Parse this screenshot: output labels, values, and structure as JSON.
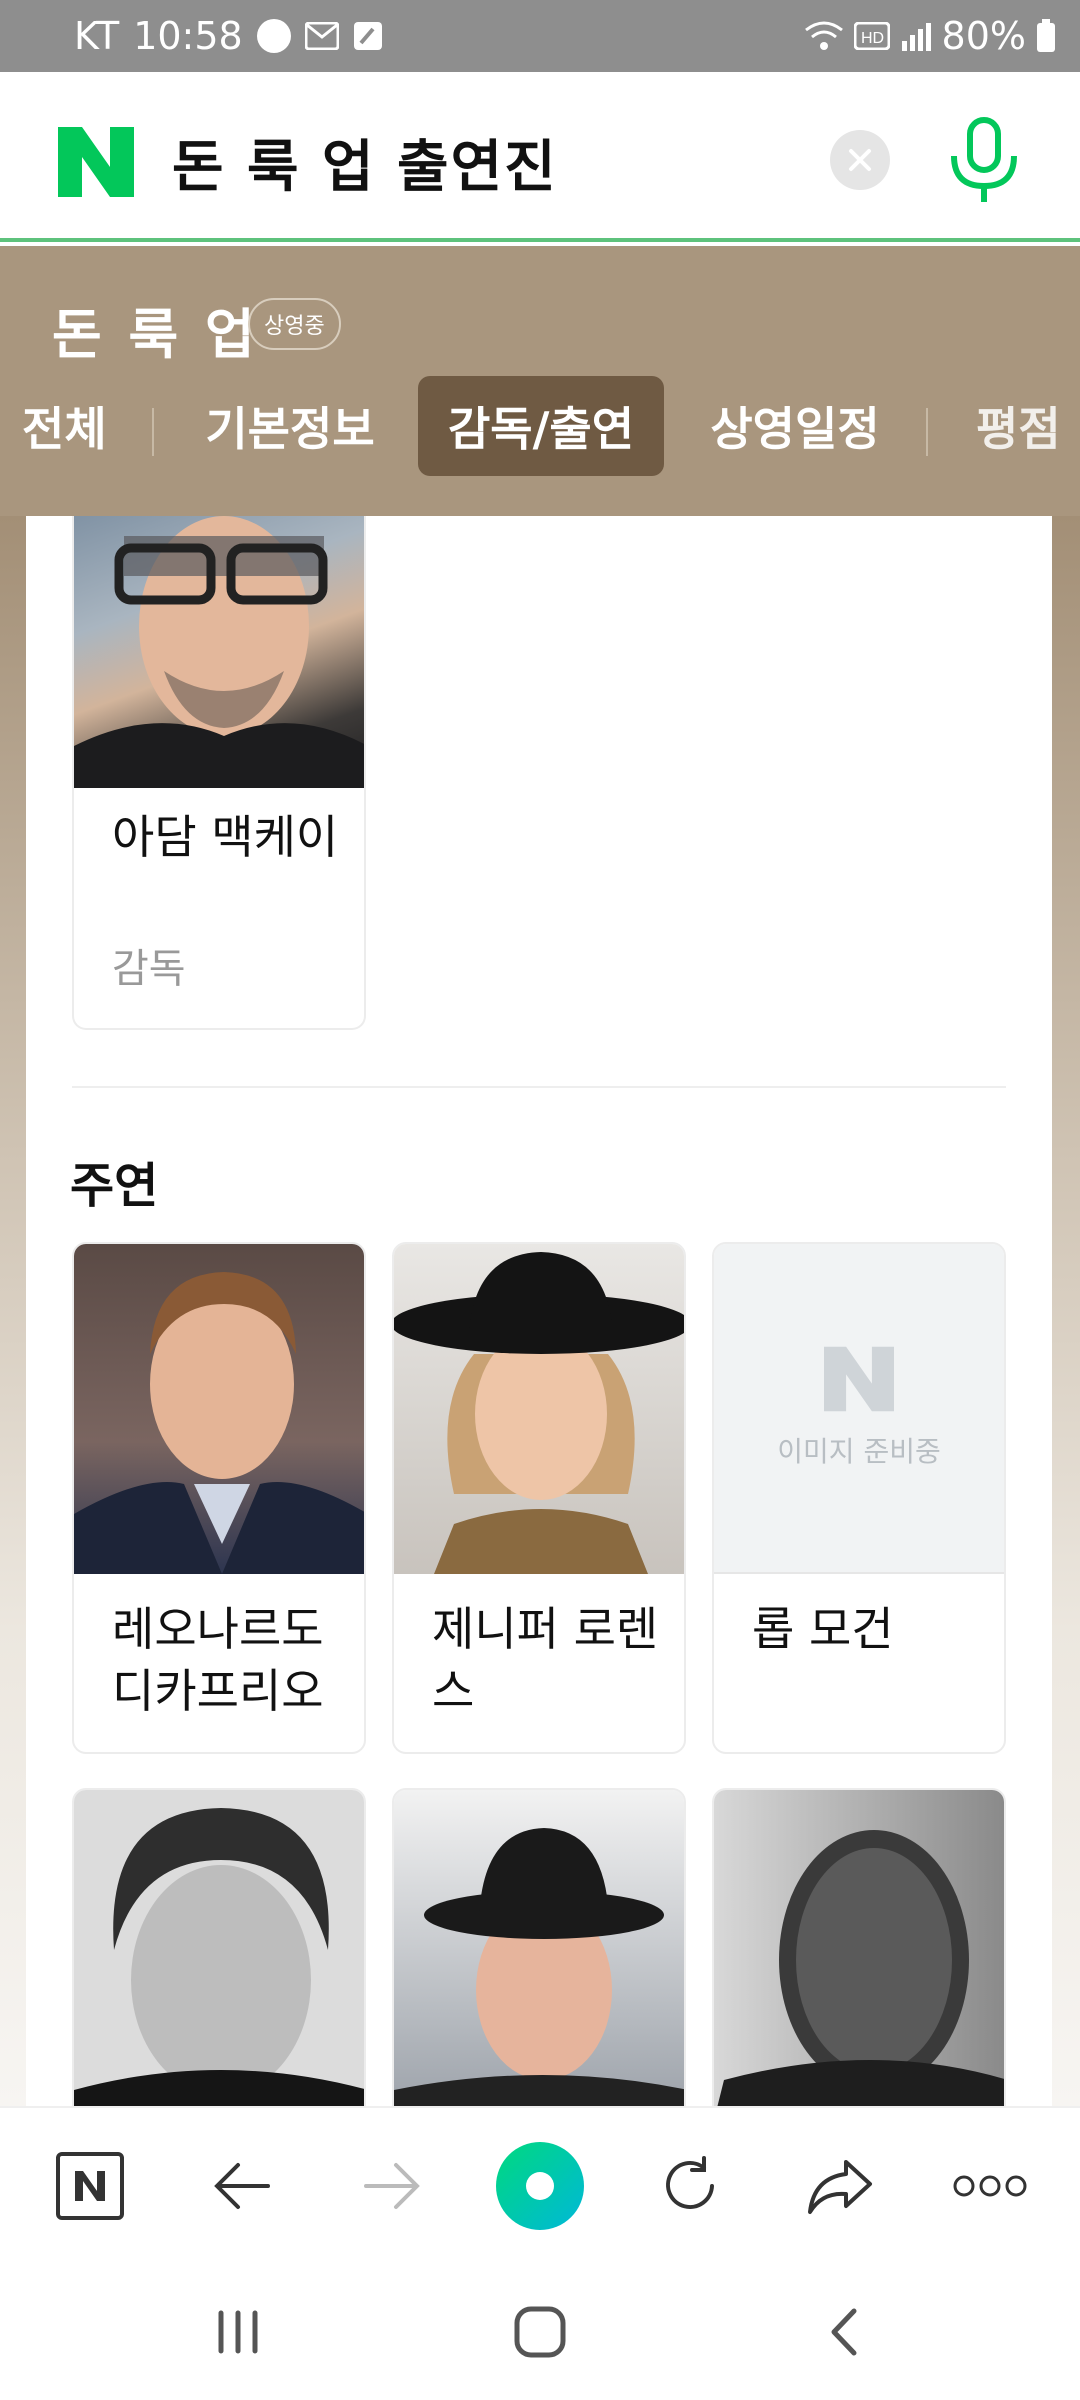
{
  "status_bar": {
    "carrier": "KT",
    "time": "10:58",
    "battery": "80%",
    "icons": [
      "x-app-icon",
      "mail-icon",
      "edit-icon",
      "wifi-icon",
      "hd-voice-icon",
      "signal-icon",
      "battery-icon"
    ]
  },
  "search": {
    "query": "돈 룩 업 출연진",
    "icons": [
      "naver-logo-icon",
      "clear-icon",
      "mic-icon"
    ],
    "accent_color": "#03c75a"
  },
  "movie": {
    "title": "돈 룩 업",
    "status": "상영중",
    "tabs": [
      "전체",
      "기본정보",
      "감독/출연",
      "상영일정",
      "평점"
    ],
    "active_tab": "감독/출연",
    "header_color": "#a9967e"
  },
  "director": {
    "name": "아담 맥케이",
    "role": "감독"
  },
  "cast_section": {
    "title": "주연",
    "people": [
      {
        "name": "레오나르도 디카프리오"
      },
      {
        "name": "제니퍼 로렌스"
      },
      {
        "name": "롭 모건",
        "placeholder": "이미지 준비중"
      }
    ]
  },
  "toolbar": {
    "icons": [
      "naver-home-icon",
      "back-arrow-icon",
      "forward-arrow-icon",
      "green-dot-icon",
      "refresh-icon",
      "share-icon",
      "more-icon"
    ]
  },
  "system_nav": {
    "icons": [
      "recent-apps-icon",
      "home-icon",
      "back-icon"
    ]
  }
}
